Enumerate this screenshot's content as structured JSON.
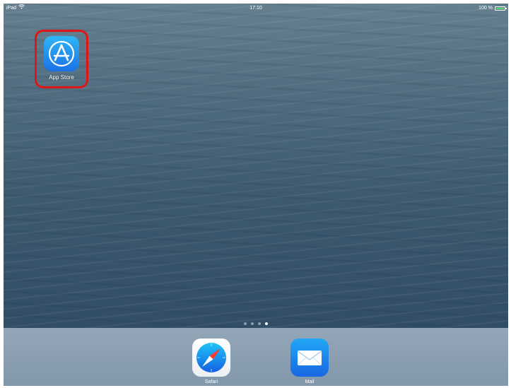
{
  "status_bar": {
    "device": "iPad",
    "time": "17:10",
    "battery_text": "100 %",
    "battery_level": 1.0
  },
  "home_screen": {
    "apps": [
      {
        "label": "App Store",
        "icon": "app-store-icon",
        "highlighted": true,
        "highlight_color": "#e01616"
      }
    ],
    "page_dots": {
      "count": 4,
      "active_index": 3
    }
  },
  "dock": {
    "apps": [
      {
        "label": "Safari",
        "icon": "safari-compass-icon"
      },
      {
        "label": "Mail",
        "icon": "mail-envelope-icon"
      }
    ]
  },
  "colors": {
    "app_store_tile": "#1a8ff0",
    "battery_fill": "#4cd964",
    "highlight_border": "#e01616"
  }
}
